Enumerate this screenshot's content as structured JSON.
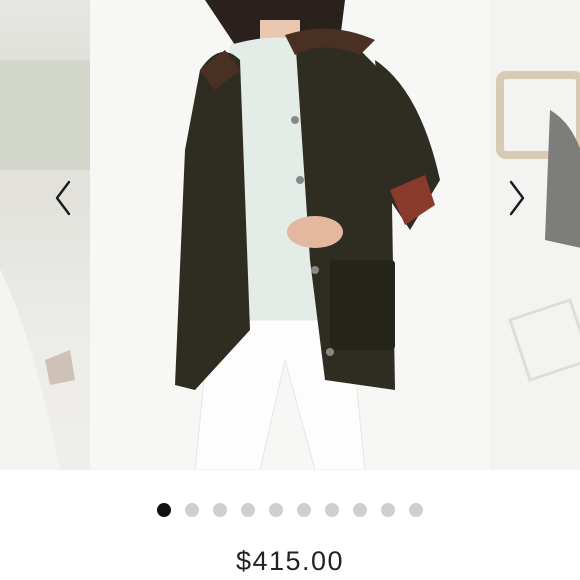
{
  "carousel": {
    "prev_icon": "chevron-left-icon",
    "next_icon": "chevron-right-icon",
    "slide_count": 10,
    "active_index": 0,
    "colors": {
      "jacket": "#2f2d22",
      "sweater": "#e3ece6",
      "jeans": "#fdfdfd",
      "collar": "#4a3023",
      "tartan": "#8a3a2c"
    }
  },
  "listing": {
    "price": "$415.00"
  }
}
